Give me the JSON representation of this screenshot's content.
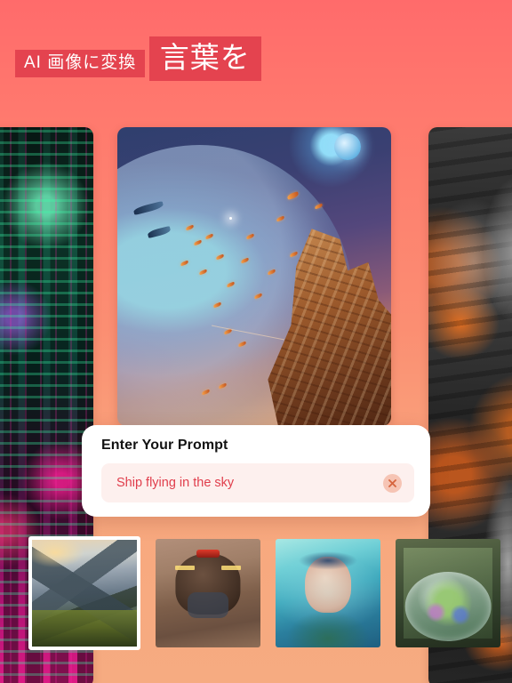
{
  "header": {
    "subtitle": "AI 画像に変換",
    "title": "言葉を",
    "banner_color": "#e4434f",
    "text_color": "#ffffff"
  },
  "background": {
    "top_color": "#ff6b6b",
    "bottom_color": "#f6ab81"
  },
  "cards": [
    {
      "name": "cyberpunk-city",
      "description": "Neon cyberpunk city street with green and magenta signage"
    },
    {
      "name": "space-galleon",
      "description": "Sailing ship flying in space beside a planet with flying ships"
    },
    {
      "name": "dark-volcano",
      "description": "Monochrome volcanic cliffs with glowing orange lava"
    }
  ],
  "dialog": {
    "title": "Enter Your Prompt",
    "prompt_value": "Ship flying in the sky",
    "prompt_placeholder": "Enter Your Prompt",
    "clear_icon": "close-x-icon",
    "text_color": "#e03e4c",
    "field_background": "#fdf0ee"
  },
  "thumbnails": [
    {
      "name": "mountain-landscape",
      "label": "Mountain landscape",
      "selected": true
    },
    {
      "name": "robot-dog",
      "label": "Robotic dog head",
      "selected": false
    },
    {
      "name": "cyber-woman",
      "label": "Cyber woman portrait",
      "selected": false
    },
    {
      "name": "terrarium",
      "label": "Glass terrarium with flowers",
      "selected": false
    }
  ]
}
